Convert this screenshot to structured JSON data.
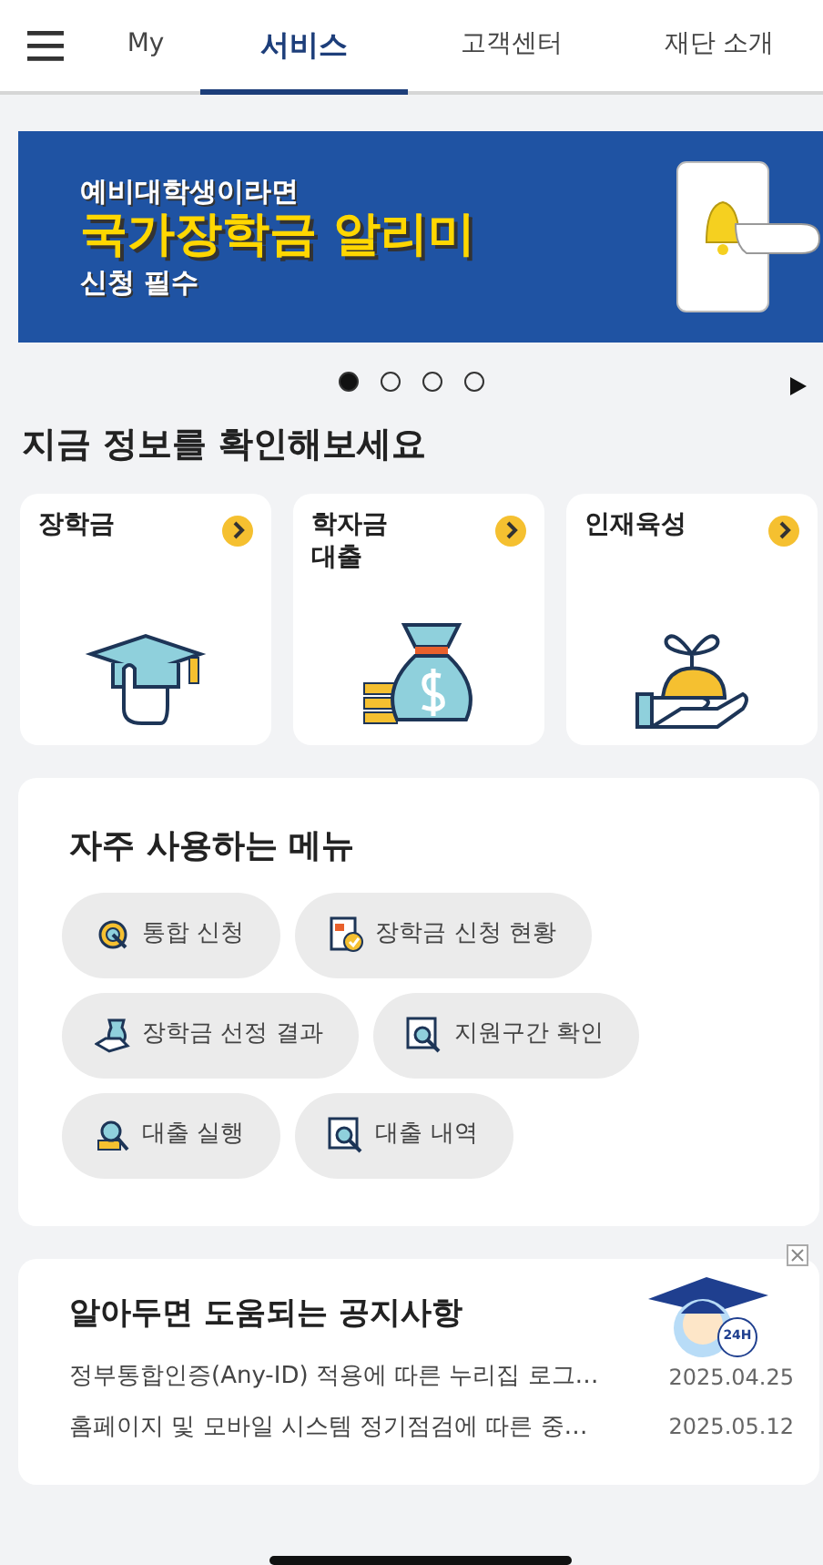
{
  "tabs": [
    {
      "label": "My",
      "selected": false
    },
    {
      "label": "서비스",
      "selected": true
    },
    {
      "label": "고객센터",
      "selected": false
    },
    {
      "label": "재단 소개",
      "selected": false
    }
  ],
  "banner": {
    "line_1": "예비대학생이라면",
    "line_2": "국가장학금 알리미",
    "line_3": "신청 필수",
    "pages": [
      {
        "selected": true
      },
      {
        "selected": false
      },
      {
        "selected": false
      },
      {
        "selected": false
      }
    ]
  },
  "info_section": {
    "title": "지금 정보를 확인해보세요",
    "cards": [
      {
        "label": "장학금",
        "kind": "cap"
      },
      {
        "label": "학자금\n대출",
        "kind": "bag"
      },
      {
        "label": "인재육성",
        "kind": "sprout"
      }
    ]
  },
  "frequent_menu": {
    "title": "자주 사용하는 메뉴",
    "items": [
      {
        "label": "통합 신청",
        "kind": "target"
      },
      {
        "label": "장학금 신청 현황",
        "kind": "doc"
      },
      {
        "label": "장학금 선정 결과",
        "kind": "hand"
      },
      {
        "label": "지원구간 확인",
        "kind": "search"
      },
      {
        "label": "대출 실행",
        "kind": "coins"
      },
      {
        "label": "대출 내역",
        "kind": "search"
      }
    ]
  },
  "notices": {
    "title": "알아두면 도움되는 공지사항",
    "items": [
      {
        "title": "정부통합인증(Any-ID) 적용에 따른 누리집 로그…",
        "date": "2025.04.25"
      },
      {
        "title": "홈페이지 및 모바일 시스템 정기점검에 따른 중…",
        "date": "2025.05.12"
      }
    ]
  },
  "chatbot": {
    "badge": "24H"
  }
}
